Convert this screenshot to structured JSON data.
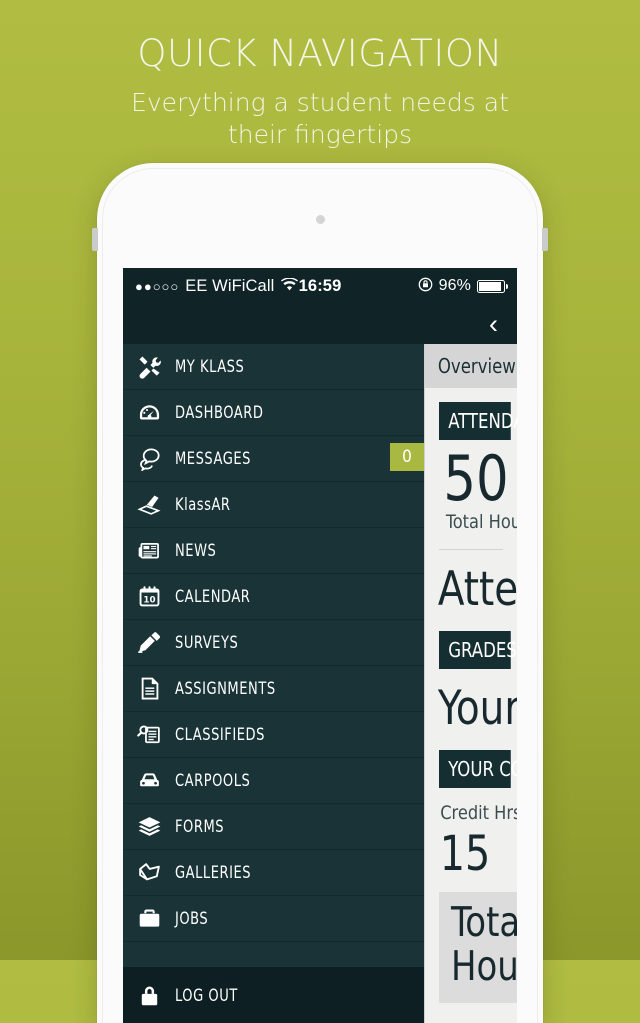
{
  "promo": {
    "title": "QUICK NAVIGATION",
    "subtitle_line1": "Everything a student needs at",
    "subtitle_line2": "their fingertips"
  },
  "statusbar": {
    "signal_dots": "●●○○○",
    "carrier": "EE WiFiCall",
    "wifi_icon": "wifi-icon",
    "time": "16:59",
    "lock_icon": "ⓘ",
    "battery_percent": "96%",
    "battery_icon": "battery-icon"
  },
  "navbar": {
    "back_label": "‹"
  },
  "menu": {
    "items": [
      {
        "label": "MY KLASS",
        "icon": "tools-icon"
      },
      {
        "label": "DASHBOARD",
        "icon": "gauge-icon"
      },
      {
        "label": "MESSAGES",
        "icon": "chat-bubbles-icon",
        "badge": "0"
      },
      {
        "label": "KlassAR",
        "icon": "scanner-icon"
      },
      {
        "label": "NEWS",
        "icon": "newspaper-icon"
      },
      {
        "label": "CALENDAR",
        "icon": "calendar-icon",
        "icon_day": "10"
      },
      {
        "label": "SURVEYS",
        "icon": "pencil-icon"
      },
      {
        "label": "ASSIGNMENTS",
        "icon": "document-icon"
      },
      {
        "label": "CLASSIFIEDS",
        "icon": "classifieds-icon"
      },
      {
        "label": "CARPOOLS",
        "icon": "car-icon"
      },
      {
        "label": "FORMS",
        "icon": "layers-icon"
      },
      {
        "label": "GALLERIES",
        "icon": "photos-icon"
      },
      {
        "label": "JOBS",
        "icon": "briefcase-icon"
      }
    ],
    "logout": {
      "label": "LOG OUT",
      "icon": "lock-icon"
    }
  },
  "content": {
    "tab_label": "Overview",
    "attendance_header": "ATTENDANCE",
    "attendance_value": "50",
    "attendance_sub": "Total Hours",
    "attendance_headline": "Attendance",
    "grades_header": "GRADES",
    "grades_headline": "Your Grades",
    "courses_header": "YOUR COURSES",
    "credit_hrs_label": "Credit Hrs",
    "credit_hrs_value": "15",
    "total_hours_line1": "Total",
    "total_hours_line2": "Hours"
  },
  "colors": {
    "background_top": "#b0bd42",
    "background_bottom": "#8b972a",
    "menu_dark": "#193336",
    "accent_badge": "#a8b840",
    "content_bg": "#f0f0ee"
  }
}
